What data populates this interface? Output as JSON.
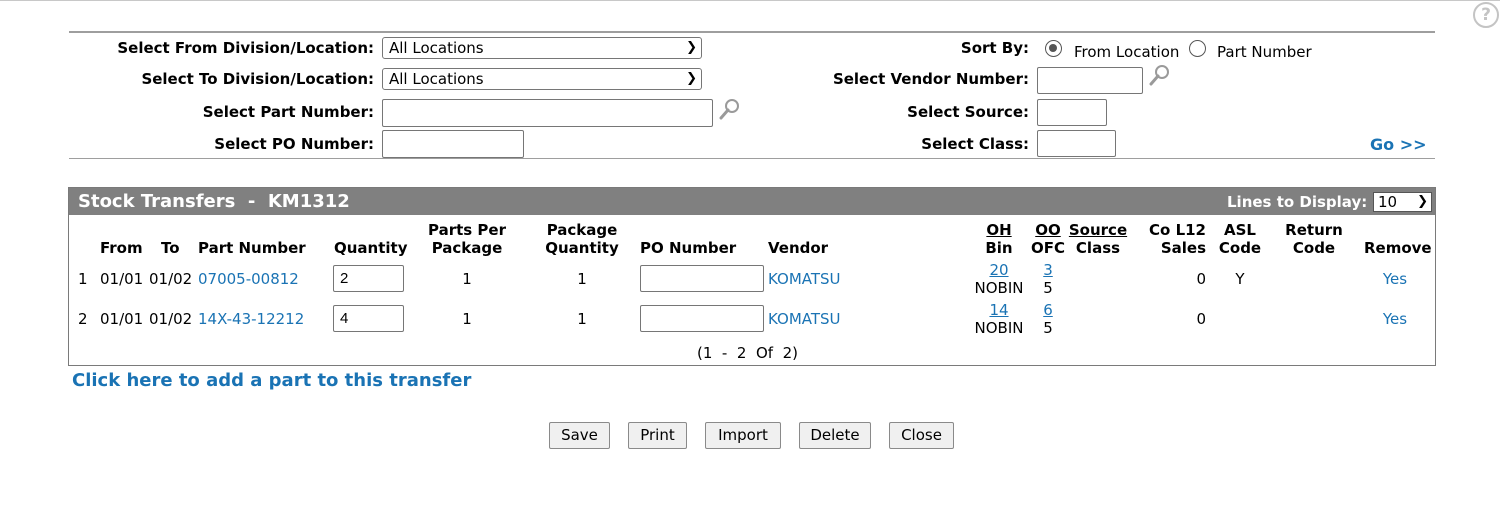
{
  "filters": {
    "from_label": "Select From Division/Location:",
    "from_value": "All Locations",
    "to_label": "Select To Division/Location:",
    "to_value": "All Locations",
    "part_label": "Select Part Number:",
    "part_value": "",
    "po_label": "Select PO Number:",
    "po_value": "",
    "sort_label": "Sort By:",
    "sort_options": [
      "From Location",
      "Part Number"
    ],
    "sort_selected": "From Location",
    "vendor_label": "Select Vendor Number:",
    "vendor_value": "",
    "source_label": "Select Source:",
    "source_value": "",
    "class_label": "Select Class:",
    "class_value": "",
    "go_label": "Go >>"
  },
  "transfer": {
    "title": "Stock Transfers  -  KM1312",
    "lines_label": "Lines to Display:",
    "lines_value": "10",
    "columns": {
      "from": "From",
      "to": "To",
      "part": "Part Number",
      "quantity": "Quantity",
      "ppp": [
        "Parts Per",
        "Package"
      ],
      "pq": [
        "Package",
        "Quantity"
      ],
      "po": "PO Number",
      "vendor": "Vendor",
      "oh_bin": [
        "OH",
        "Bin"
      ],
      "oo_ofc": [
        "OO",
        "OFC"
      ],
      "source_class": [
        "Source",
        "Class"
      ],
      "co_sales": [
        "Co L12",
        "Sales"
      ],
      "asl": [
        "ASL",
        "Code"
      ],
      "return": [
        "Return",
        "Code"
      ],
      "remove": "Remove"
    },
    "rows": [
      {
        "num": "1",
        "from": "01/01",
        "to": "01/02",
        "part": "07005-00812",
        "quantity": "2",
        "ppp": "1",
        "pq": "1",
        "po": "",
        "vendor": "KOMATSU",
        "oh": "20",
        "bin": "NOBIN",
        "oo": "3",
        "ofc": "5",
        "source": "",
        "class": "",
        "co_sales": "0",
        "asl": "Y",
        "return": "",
        "remove": "Yes"
      },
      {
        "num": "2",
        "from": "01/01",
        "to": "01/02",
        "part": "14X-43-12212",
        "quantity": "4",
        "ppp": "1",
        "pq": "1",
        "po": "",
        "vendor": "KOMATSU",
        "oh": "14",
        "bin": "NOBIN",
        "oo": "6",
        "ofc": "5",
        "source": "",
        "class": "",
        "co_sales": "0",
        "asl": "",
        "return": "",
        "remove": "Yes"
      }
    ],
    "pagination": "(1  -  2  Of  2)"
  },
  "add_part_link": "Click here to add a part to this transfer",
  "buttons": {
    "save": "Save",
    "print": "Print",
    "import": "Import",
    "delete": "Delete",
    "close": "Close"
  },
  "icons": {
    "help": "help-icon",
    "search": "magnifier-icon"
  },
  "colors": {
    "link": "#1a73b4",
    "panel_header": "#808080"
  }
}
